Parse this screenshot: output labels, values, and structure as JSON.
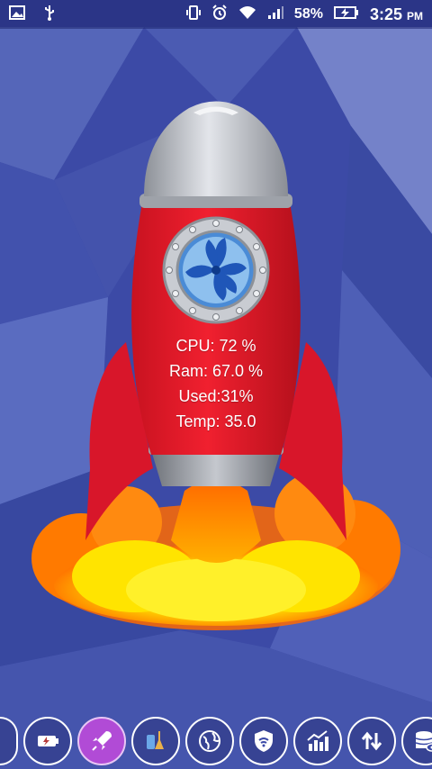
{
  "statusbar": {
    "battery_percent": "58%",
    "time": "3:25",
    "ampm": "PM"
  },
  "stats": {
    "cpu": "CPU: 72 %",
    "ram": "Ram: 67.0 %",
    "used": "Used:31%",
    "temp": "Temp: 35.0"
  },
  "colors": {
    "rocket_body": "#e11c2c",
    "nose": "#b8bcc4",
    "window_ring": "#c7c9cf",
    "fan": "#1f56b8",
    "flame_outer": "#ff7a00",
    "flame_inner": "#ffe000",
    "active_nav": "#b14bd6"
  },
  "nav": {
    "items": [
      {
        "name": "battery-saver-icon"
      },
      {
        "name": "rocket-boost-icon"
      },
      {
        "name": "cleaner-icon"
      },
      {
        "name": "globe-icon"
      },
      {
        "name": "wifi-shield-icon"
      },
      {
        "name": "chart-trend-icon"
      },
      {
        "name": "data-transfer-icon"
      },
      {
        "name": "storage-icon"
      }
    ]
  }
}
